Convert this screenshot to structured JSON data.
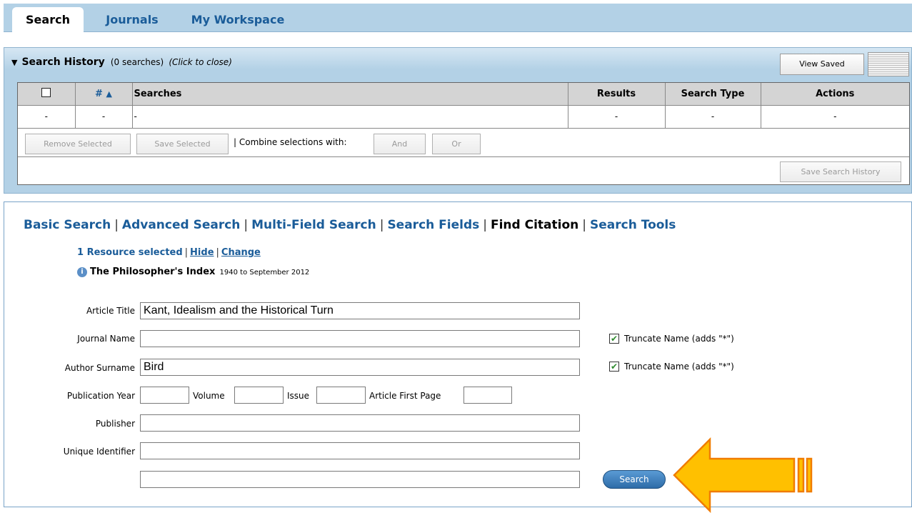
{
  "tabs": [
    {
      "label": "Search"
    },
    {
      "label": "Journals"
    },
    {
      "label": "My Workspace"
    }
  ],
  "history": {
    "title": "Search History",
    "count": "(0 searches)",
    "toggle": "(Click to close)",
    "view_saved": "View Saved",
    "columns": [
      "#",
      "Searches",
      "Results",
      "Search Type",
      "Actions"
    ],
    "row": [
      "-",
      "-",
      "-",
      "-",
      "-",
      "-"
    ],
    "remove_selected": "Remove Selected",
    "save_selected": "Save Selected",
    "combine_label": "| Combine selections with:",
    "and": "And",
    "or": "Or",
    "save_history": "Save Search History"
  },
  "subnav": {
    "basic": "Basic Search",
    "advanced": "Advanced Search",
    "multi": "Multi-Field Search",
    "fields": "Search Fields",
    "citation": "Find Citation",
    "tools": "Search Tools"
  },
  "resources": {
    "selected": "1 Resource selected",
    "hide": "Hide",
    "change": "Change",
    "db_name": "The Philosopher's Index",
    "db_range": "1940 to September 2012"
  },
  "form": {
    "article_title_label": "Article Title",
    "article_title_value": "Kant, Idealism and the Historical Turn",
    "journal_name_label": "Journal Name",
    "journal_name_value": "",
    "author_surname_label": "Author Surname",
    "author_surname_value": "Bird",
    "truncate_label": "Truncate Name (adds \"*\")",
    "pub_year_label": "Publication Year",
    "volume_label": "Volume",
    "issue_label": "Issue",
    "first_page_label": "Article First Page",
    "publisher_label": "Publisher",
    "unique_id_label": "Unique Identifier",
    "search_button": "Search"
  },
  "colors": {
    "accent": "#1a5c99",
    "banner": "#b3d1e6",
    "arrow_fill": "#ffc000",
    "arrow_stroke": "#f07c00"
  }
}
